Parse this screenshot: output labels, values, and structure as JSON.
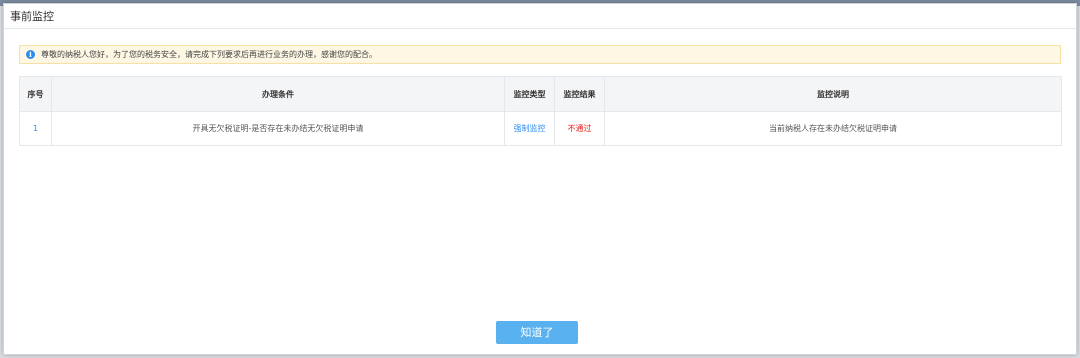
{
  "dialog": {
    "title": "事前监控"
  },
  "notice": {
    "icon": "info-icon",
    "text": "尊敬的纳税人您好，为了您的税务安全，请完成下列要求后再进行业务的办理，感谢您的配合。"
  },
  "table": {
    "columns": [
      "序号",
      "办理条件",
      "监控类型",
      "监控结果",
      "监控说明"
    ],
    "rows": [
      {
        "index": "1",
        "condition": "开具无欠税证明-是否存在未办结无欠税证明申请",
        "type": "强制监控",
        "result": "不通过",
        "description": "当前纳税人存在未办结欠税证明申请"
      }
    ]
  },
  "footer": {
    "confirm_label": "知道了"
  },
  "colors": {
    "accent": "#2d8cf0",
    "fail": "#ee1c1c",
    "button": "#5ab1ef",
    "notice_bg": "#fdf7e3"
  }
}
